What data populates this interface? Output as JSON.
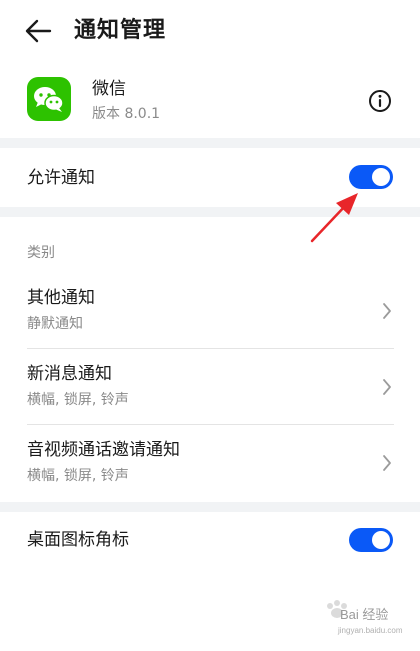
{
  "header": {
    "title": "通知管理",
    "back_icon": "arrow-left-icon"
  },
  "app": {
    "name": "微信",
    "version": "版本 8.0.1",
    "icon": "wechat-icon",
    "icon_color": "#2dc200",
    "info_icon": "info-icon"
  },
  "allow_notifications": {
    "label": "允许通知",
    "enabled": true
  },
  "category": {
    "label": "类别",
    "items": [
      {
        "title": "其他通知",
        "subtitle": "静默通知"
      },
      {
        "title": "新消息通知",
        "subtitle": "横幅, 锁屏, 铃声"
      },
      {
        "title": "音视频通话邀请通知",
        "subtitle": "横幅, 锁屏, 铃声"
      }
    ]
  },
  "badge": {
    "label": "桌面图标角标",
    "enabled": true
  },
  "colors": {
    "accent": "#0a59f7",
    "annotation_arrow": "#e8262a",
    "separator": "#f1f3f5"
  },
  "watermark": {
    "text": "Bai 经验",
    "url": "jingyan.baidu.com"
  }
}
